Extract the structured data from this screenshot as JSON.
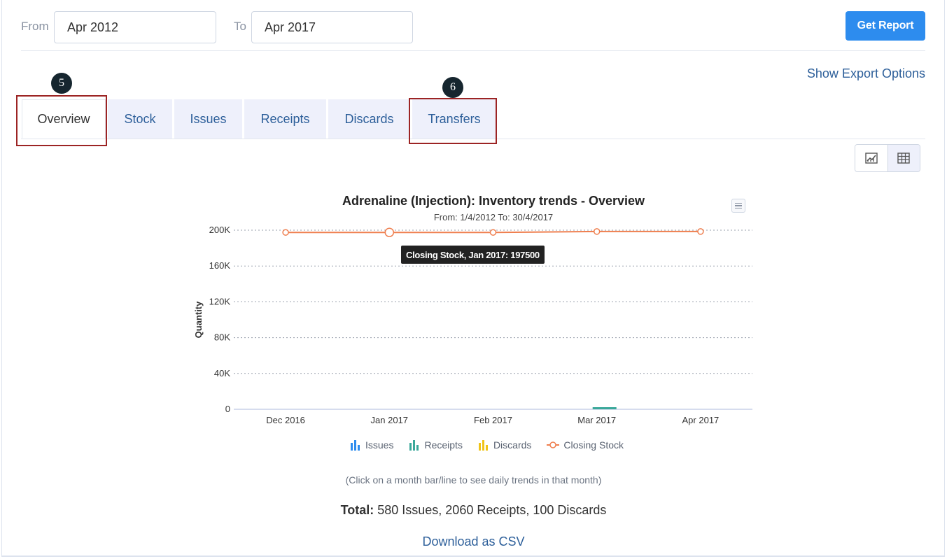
{
  "filters": {
    "from_label": "From",
    "from_value": "Apr 2012",
    "to_label": "To",
    "to_value": "Apr 2017",
    "get_report_label": "Get Report"
  },
  "export": {
    "label": "Show Export Options"
  },
  "tabs": [
    {
      "label": "Overview",
      "active": true
    },
    {
      "label": "Stock"
    },
    {
      "label": "Issues"
    },
    {
      "label": "Receipts"
    },
    {
      "label": "Discards"
    },
    {
      "label": "Transfers"
    }
  ],
  "annotations": {
    "badge_overview": "5",
    "badge_transfers": "6"
  },
  "view_toggle": {
    "chart_icon": "chart-icon",
    "table_icon": "table-icon"
  },
  "chart_data": {
    "type": "line",
    "title": "Adrenaline (Injection): Inventory trends - Overview",
    "subtitle": "From: 1/4/2012 To: 30/4/2017",
    "ylabel": "Quantity",
    "ylim": [
      0,
      200000
    ],
    "y_ticks": [
      "0",
      "40K",
      "80K",
      "120K",
      "160K",
      "200K"
    ],
    "categories": [
      "Dec 2016",
      "Jan 2017",
      "Feb 2017",
      "Mar 2017",
      "Apr 2017"
    ],
    "series": [
      {
        "name": "Issues",
        "type": "bar",
        "color": "#2d8cee",
        "values": [
          0,
          0,
          0,
          0,
          0
        ]
      },
      {
        "name": "Receipts",
        "type": "bar",
        "color": "#3aa89a",
        "values": [
          0,
          0,
          0,
          2060,
          0
        ]
      },
      {
        "name": "Discards",
        "type": "bar",
        "color": "#f0c419",
        "values": [
          0,
          0,
          0,
          0,
          0
        ]
      },
      {
        "name": "Closing Stock",
        "type": "line",
        "color": "#ef7f4f",
        "values": [
          197500,
          197500,
          197500,
          198500,
          198500
        ]
      }
    ],
    "tooltip": "Closing Stock, Jan 2017: 197500",
    "grid": true,
    "legend_position": "bottom"
  },
  "footer": {
    "note": "(Click on a month bar/line to see daily trends in that month)",
    "total_label": "Total:",
    "total_text": " 580 Issues, 2060 Receipts, 100 Discards",
    "download_label": "Download as CSV"
  }
}
